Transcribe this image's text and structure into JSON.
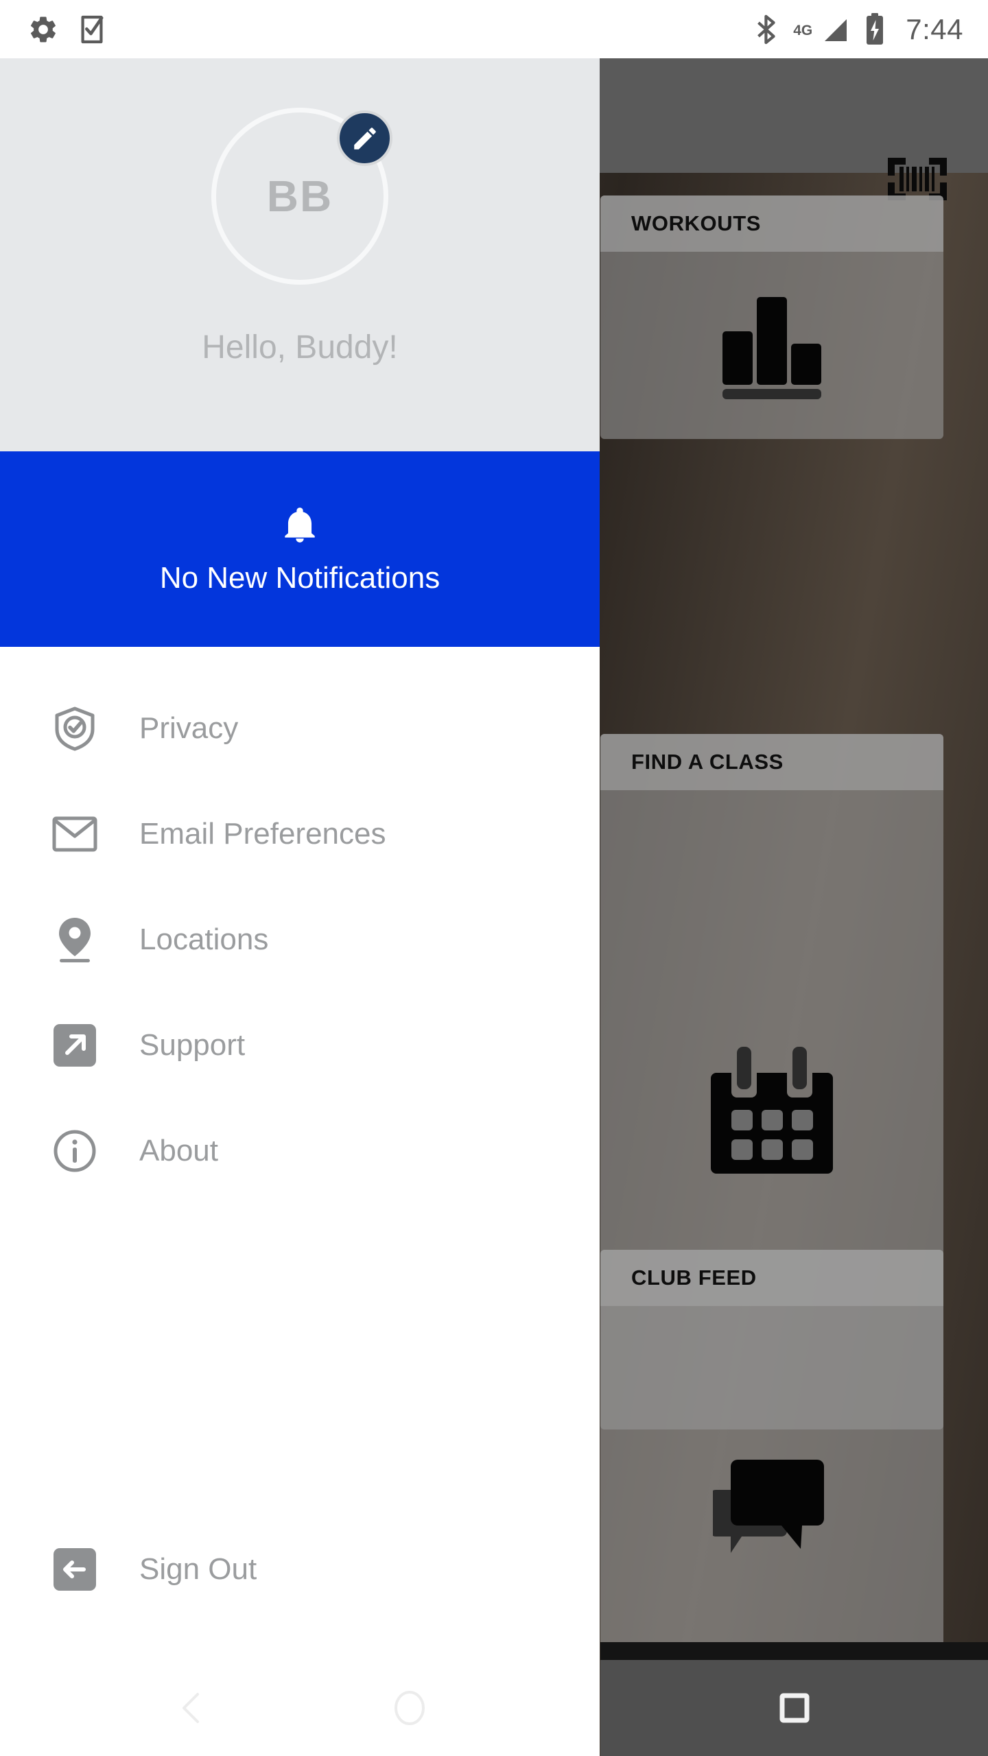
{
  "status_bar": {
    "left_icons": [
      "gear-icon",
      "phone-check-icon"
    ],
    "right_icons": [
      "bluetooth-icon",
      "signal-icon",
      "battery-charging-icon"
    ],
    "network_label": "4G",
    "time": "7:44"
  },
  "drawer": {
    "avatar": {
      "initials": "BB",
      "edit_badge_icon": "pencil-icon",
      "edit_badge_color": "#1e3a5f"
    },
    "greeting": "Hello, Buddy!",
    "notification": {
      "icon": "bell-icon",
      "text": "No New Notifications",
      "background_color": "#0336dc",
      "text_color": "#ffffff"
    },
    "menu_items": [
      {
        "label": "Privacy",
        "icon": "shield-check-icon"
      },
      {
        "label": "Email Preferences",
        "icon": "envelope-icon"
      },
      {
        "label": "Locations",
        "icon": "map-pin-icon"
      },
      {
        "label": "Support",
        "icon": "external-link-icon"
      },
      {
        "label": "About",
        "icon": "info-circle-icon"
      }
    ],
    "sign_out": {
      "label": "Sign Out",
      "icon": "sign-out-icon"
    },
    "header_background": "#e6e8ea",
    "label_color": "#9a9c9e"
  },
  "background_app": {
    "topbar": {
      "scan_icon": "barcode-scan-icon"
    },
    "cards": [
      {
        "title": "WORKOUTS",
        "icon": "bar-chart-icon"
      },
      {
        "title": "FIND A CLASS",
        "icon": "calendar-icon"
      },
      {
        "title": "CLUB FEED",
        "icon": "chat-bubbles-icon"
      }
    ]
  },
  "system_nav": {
    "back_icon": "back-chevron-icon",
    "home_icon": "home-circle-icon",
    "recents_icon": "recents-square-icon"
  }
}
